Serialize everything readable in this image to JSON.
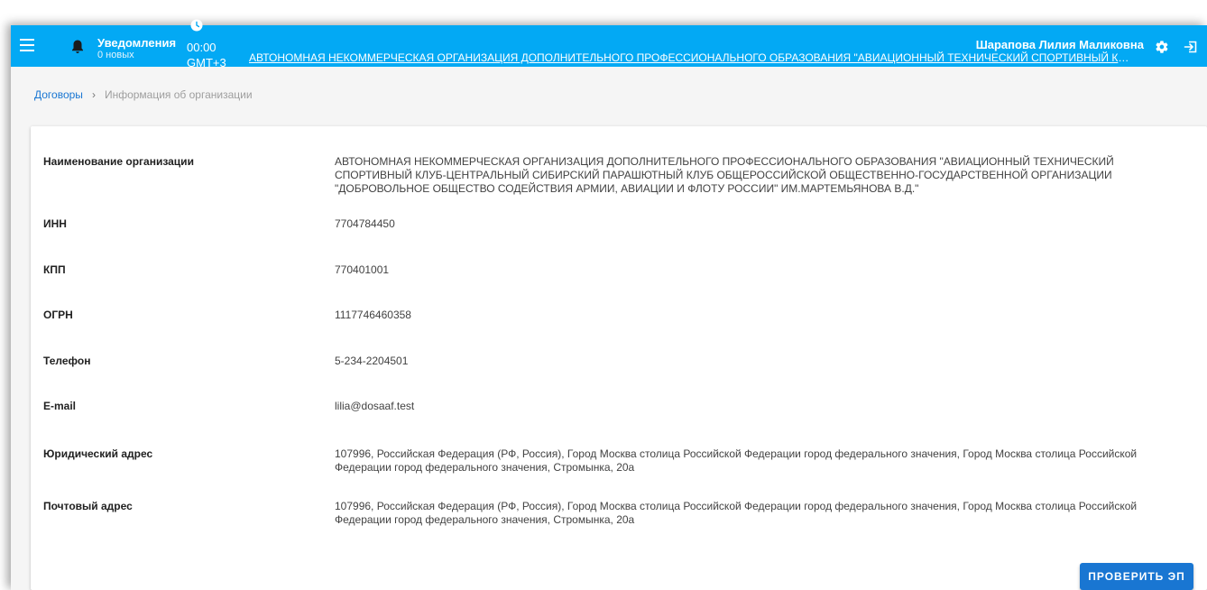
{
  "header": {
    "notifications_title": "Уведомления",
    "notifications_count": "0 новых",
    "time": "00:00",
    "timezone": "GMT+3",
    "organization_link": "АВТОНОМНАЯ НЕКОММЕРЧЕСКАЯ ОРГАНИЗАЦИЯ ДОПОЛНИТЕЛЬНОГО ПРОФЕССИОНАЛЬНОГО ОБРАЗОВАНИЯ \"АВИАЦИОННЫЙ ТЕХНИЧЕСКИЙ СПОРТИВНЫЙ КЛУБ-ЦЕНТРАЛЬНЫЙ СИБИРСКИЙ ПАРАШЮТНЫЙ КЛУБ ОБЩЕРОССИЙСКОЙ ОБЩЕСТВЕННО-ГОСУДАРСТВЕННОЙ ОРГАНИЗАЦИИ \"ДОБРОВОЛЬНОЕ ОБЩЕСТВО СОДЕЙСТВИЯ АРМИИ, АВИАЦИИ И ФЛОТУ РОССИИ\" ИМ.МАРТЕМЬЯНОВА В.Д.\"",
    "user_name": "Шарапова Лилия Маликовна",
    "bar_color": "#03a9f4",
    "icons": [
      "menu-icon",
      "bell-icon",
      "clock-icon",
      "gear-icon",
      "logout-icon"
    ]
  },
  "breadcrumb": {
    "link": "Договоры",
    "separator": "›",
    "current": "Информация об организации"
  },
  "org_info": {
    "rows": [
      {
        "label": "Наименование организации",
        "value": "АВТОНОМНАЯ НЕКОММЕРЧЕСКАЯ ОРГАНИЗАЦИЯ ДОПОЛНИТЕЛЬНОГО ПРОФЕССИОНАЛЬНОГО ОБРАЗОВАНИЯ \"АВИАЦИОННЫЙ ТЕХНИЧЕСКИЙ СПОРТИВНЫЙ КЛУБ-ЦЕНТРАЛЬНЫЙ СИБИРСКИЙ ПАРАШЮТНЫЙ КЛУБ ОБЩЕРОССИЙСКОЙ ОБЩЕСТВЕННО-ГОСУДАРСТВЕННОЙ ОРГАНИЗАЦИИ \"ДОБРОВОЛЬНОЕ ОБЩЕСТВО СОДЕЙСТВИЯ АРМИИ, АВИАЦИИ И ФЛОТУ РОССИИ\" ИМ.МАРТЕМЬЯНОВА В.Д.\""
      },
      {
        "label": "ИНН",
        "value": "7704784450"
      },
      {
        "label": "КПП",
        "value": "770401001"
      },
      {
        "label": "ОГРН",
        "value": "1117746460358"
      },
      {
        "label": "Телефон",
        "value": "5-234-2204501"
      },
      {
        "label": "E-mail",
        "value": "lilia@dosaaf.test"
      },
      {
        "label": "Юридический адрес",
        "value": "107996, Российская Федерация (РФ, Россия), Город Москва столица Российской Федерации город федерального значения, Город Москва столица Российской Федерации город федерального значения, Стромынка, 20а"
      },
      {
        "label": "Почтовый адрес",
        "value": "107996, Российская Федерация (РФ, Россия), Город Москва столица Российской Федерации город федерального значения, Город Москва столица Российской Федерации город федерального значения, Стромынка, 20а"
      }
    ],
    "check_button": "ПРОВЕРИТЬ ЭП"
  }
}
